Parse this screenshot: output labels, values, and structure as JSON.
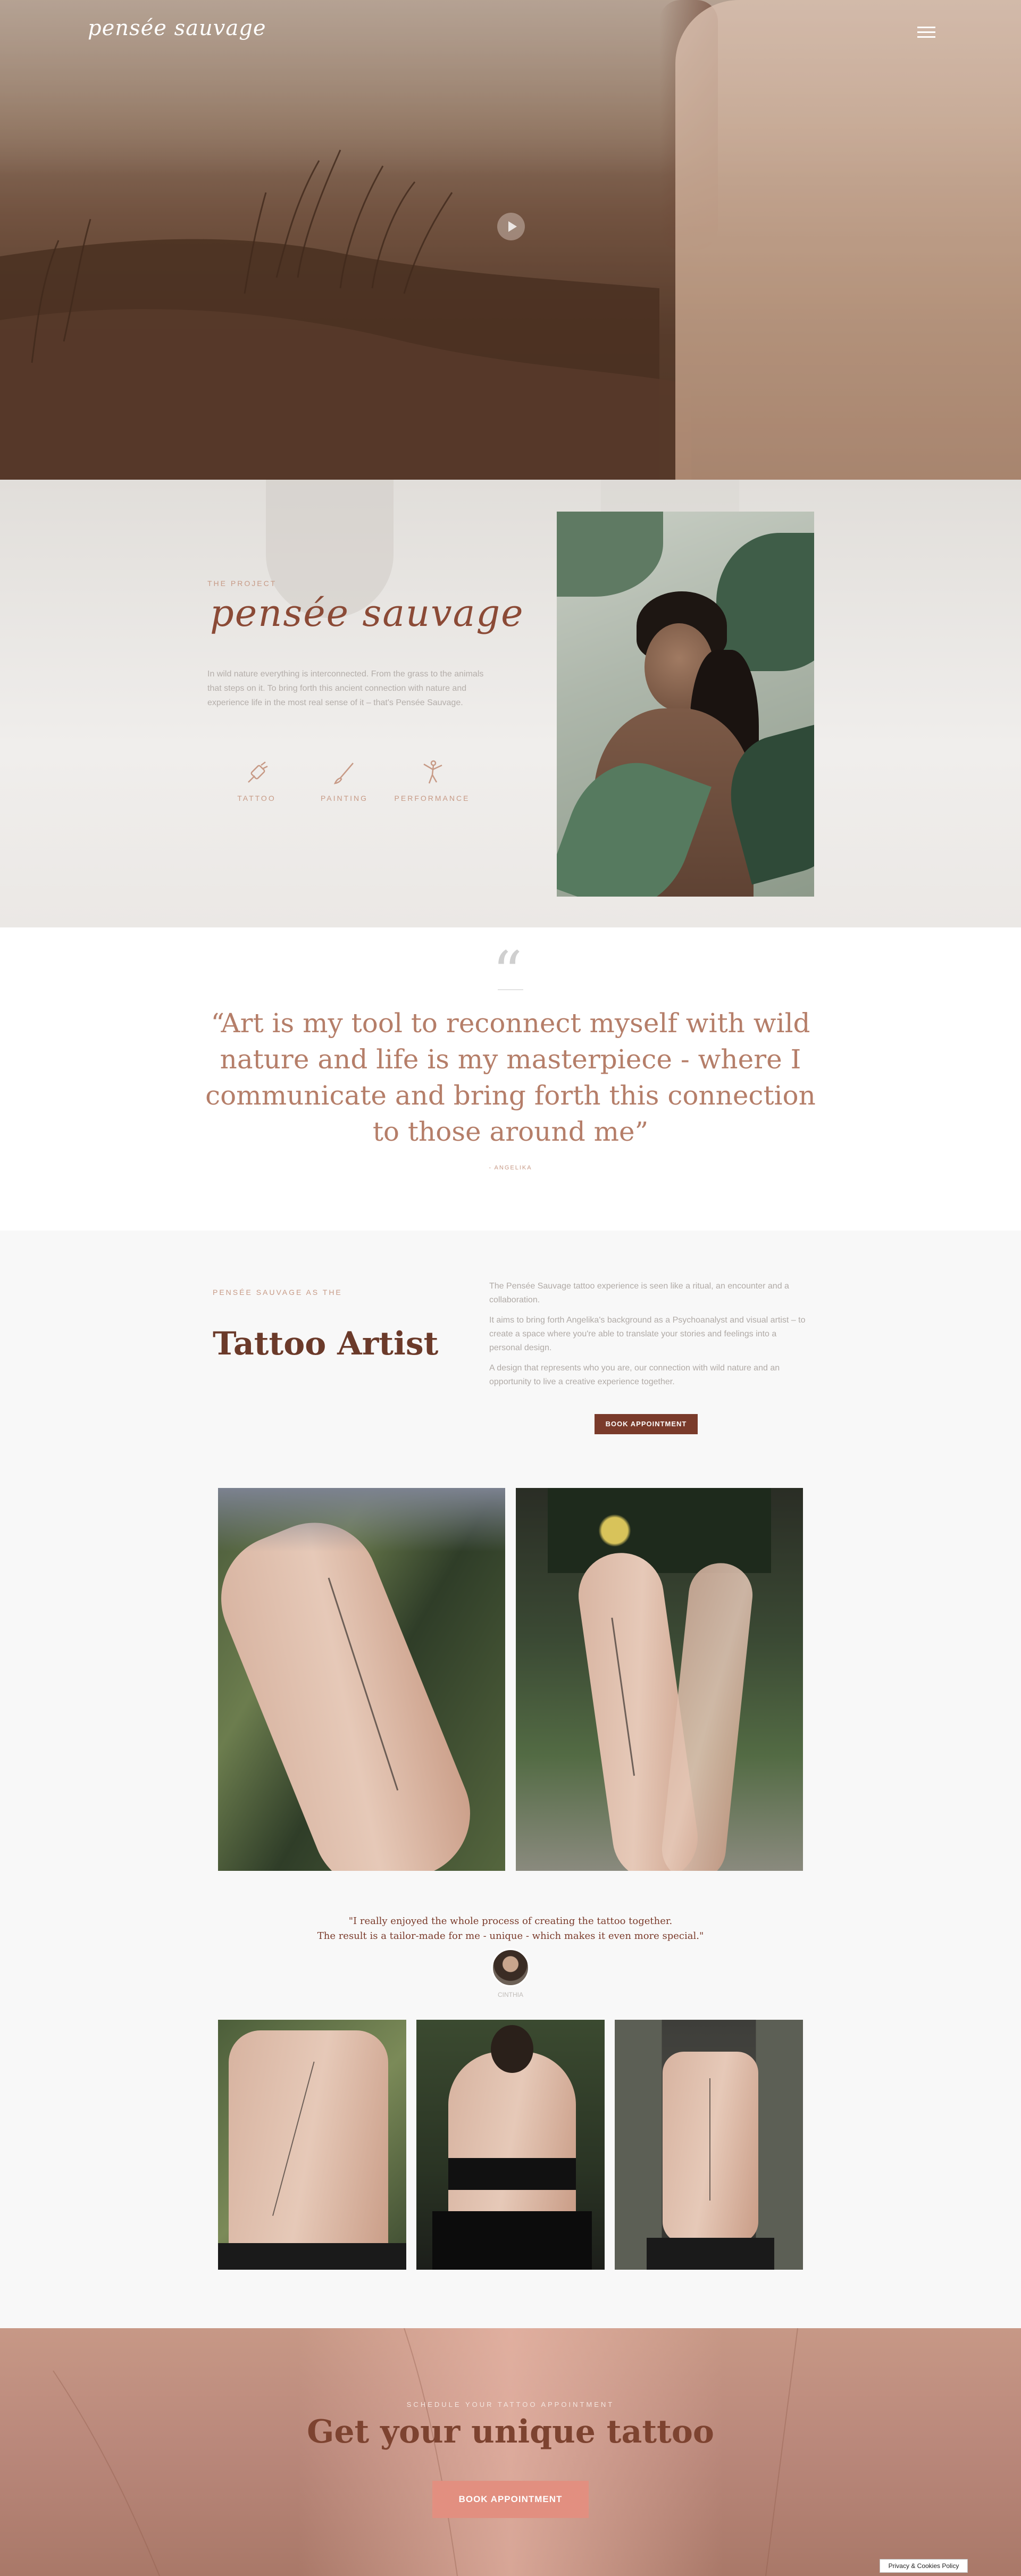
{
  "header": {
    "logo_text": "pensée sauvage",
    "menu_icon": "hamburger-icon",
    "video_icon": "play-icon"
  },
  "project": {
    "eyebrow": "THE PROJECT",
    "script_title": "pensée sauvage",
    "text": "In wild nature everything is interconnected. From the grass to the animals that steps on it. To bring forth this ancient connection with nature and experience life in the most real sense of it – that's Pensée Sauvage.",
    "services": [
      {
        "label": "TATTOO",
        "icon": "tattoo-machine-icon"
      },
      {
        "label": "PAINTING",
        "icon": "paintbrush-icon"
      },
      {
        "label": "PERFORMANCE",
        "icon": "dancer-icon"
      }
    ]
  },
  "quote": {
    "text": "“Art is my tool to reconnect myself with wild nature and life is my masterpiece - where I communicate and bring forth this connection to those around me”",
    "author": "- ANGELIKA"
  },
  "tattoo": {
    "eyebrow": "PENSÉE SAUVAGE AS THE",
    "title": "Tattoo Artist",
    "paragraphs": [
      "The Pensée Sauvage tattoo experience is seen like a ritual, an encounter and a collaboration.",
      "It aims to bring forth Angelika's background as a Psychoanalyst and visual artist – to create a space where you're able to translate your stories and feelings into a personal design.",
      "A design that represents who you are, our connection with wild nature and an opportunity to live a creative experience together."
    ],
    "book_label": "BOOK APPOINTMENT",
    "testimonial_line1": "\"I really enjoyed the whole process of creating the tattoo together.",
    "testimonial_line2": "The result is a tailor-made for me - unique - which makes it even more special.\"",
    "testimonial_author": "CINTHIA"
  },
  "cta": {
    "eyebrow": "SCHEDULE YOUR TATTOO APPOINTMENT",
    "title": "Get your unique tattoo",
    "button": "BOOK APPOINTMENT"
  },
  "cookie": {
    "label": "Privacy & Cookies Policy"
  },
  "colors": {
    "accent": "#7a3b2b",
    "rose": "#c79a86",
    "cta_button": "#e28f80"
  }
}
